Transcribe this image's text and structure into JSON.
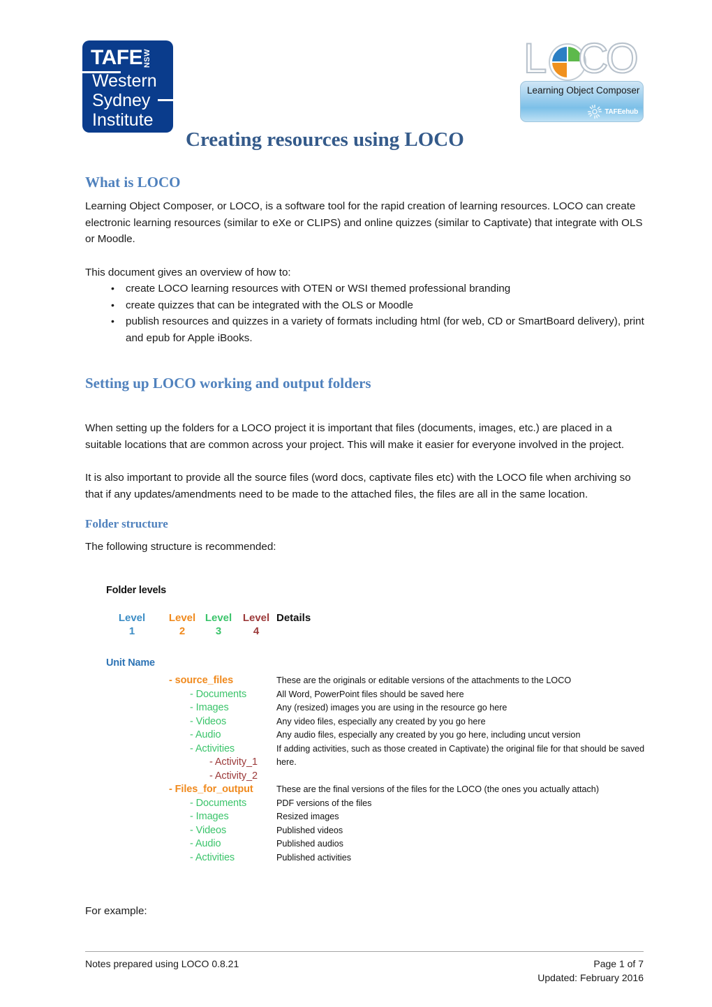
{
  "document": {
    "title": "Creating resources using LOCO"
  },
  "logos": {
    "tafe": {
      "name": "tafe-nsw-western-sydney-institute-logo",
      "acronym": "TAFE",
      "state": "NSW",
      "line1": "Western",
      "line2": "Sydney",
      "line3": "Institute"
    },
    "loco": {
      "name": "loco-learning-object-composer-logo",
      "letter_l": "L",
      "letter_c": "C",
      "letter_o": "O",
      "tagline": "Learning Object Composer",
      "hub_label": "TAFEehub"
    }
  },
  "sections": {
    "what_is_loco": {
      "heading": "What is LOCO",
      "paragraph": "Learning Object Composer, or LOCO, is a software tool for the rapid creation of learning resources. LOCO can create electronic learning resources (similar to eXe or CLIPS) and online quizzes (similar to Captivate) that integrate with OLS or Moodle.",
      "intro": "This document gives an overview of how to:",
      "bullets": [
        "create LOCO learning resources with OTEN or WSI themed professional branding",
        "create quizzes that can be integrated with the OLS or Moodle",
        "publish resources and quizzes in a variety of formats including html (for web, CD or SmartBoard delivery), print and epub for Apple iBooks."
      ]
    },
    "setting_up": {
      "heading": "Setting up LOCO working and output folders",
      "paragraph1": "When setting up the folders for a LOCO project it is important that files (documents, images, etc.) are placed in a suitable locations that are common across your project. This will make it easier for everyone involved in the project.",
      "paragraph2": "It is also important to provide all the source files (word docs, captivate files etc) with the LOCO file when archiving so that if any updates/amendments need to be made to the attached files, the files are all in the same location."
    },
    "folder_structure": {
      "heading": "Folder structure",
      "intro": "The following structure is recommended:",
      "for_example": "For example:"
    }
  },
  "diagram": {
    "title": "Folder levels",
    "columns": [
      {
        "label": "Level",
        "number": "1",
        "color": "#3C8DC5"
      },
      {
        "label": "Level",
        "number": "2",
        "color": "#F08A1E"
      },
      {
        "label": "Level",
        "number": "3",
        "color": "#3BC46B"
      },
      {
        "label": "Level",
        "number": "4",
        "color": "#9C3A3A"
      }
    ],
    "details_header": "Details",
    "root": "Unit Name",
    "rows": [
      {
        "label": "- source_files",
        "level": 2,
        "bold": true,
        "detail": "These are the originals or editable versions of the attachments to the LOCO"
      },
      {
        "label": "- Documents",
        "level": 3,
        "bold": false,
        "detail": "All Word, PowerPoint files should be saved here"
      },
      {
        "label": "- Images",
        "level": 3,
        "bold": false,
        "detail": "Any (resized) images you are using in the resource go here"
      },
      {
        "label": "- Videos",
        "level": 3,
        "bold": false,
        "detail": "Any video files, especially any created by you go here"
      },
      {
        "label": "- Audio",
        "level": 3,
        "bold": false,
        "detail": "Any audio files, especially any created by you go here, including uncut version"
      },
      {
        "label": "- Activities",
        "level": 3,
        "bold": false,
        "detail": "If adding activities, such as those created in Captivate) the original file for that should be saved here."
      },
      {
        "label": "- Activity_1",
        "level": 4,
        "bold": false,
        "detail": ""
      },
      {
        "label": "- Activity_2",
        "level": 4,
        "bold": false,
        "detail": ""
      },
      {
        "label": "- Files_for_output",
        "level": 2,
        "bold": true,
        "detail": "These are the final versions of the files for the LOCO (the ones you actually attach)"
      },
      {
        "label": "- Documents",
        "level": 3,
        "bold": false,
        "detail": "PDF versions of the files"
      },
      {
        "label": "- Images",
        "level": 3,
        "bold": false,
        "detail": "Resized images"
      },
      {
        "label": "- Videos",
        "level": 3,
        "bold": false,
        "detail": "Published videos"
      },
      {
        "label": "- Audio",
        "level": 3,
        "bold": false,
        "detail": "Published audios"
      },
      {
        "label": "- Activities",
        "level": 3,
        "bold": false,
        "detail": "Published activities"
      }
    ]
  },
  "footer": {
    "left": "Notes prepared using LOCO 0.8.21",
    "page": "Page 1 of 7",
    "updated": "Updated: February 2016"
  },
  "colors": {
    "title_blue": "#345A8A",
    "heading_blue": "#4F81BD",
    "tafe_blue": "#0A3C8C",
    "unit_name_blue": "#2E74B5"
  }
}
